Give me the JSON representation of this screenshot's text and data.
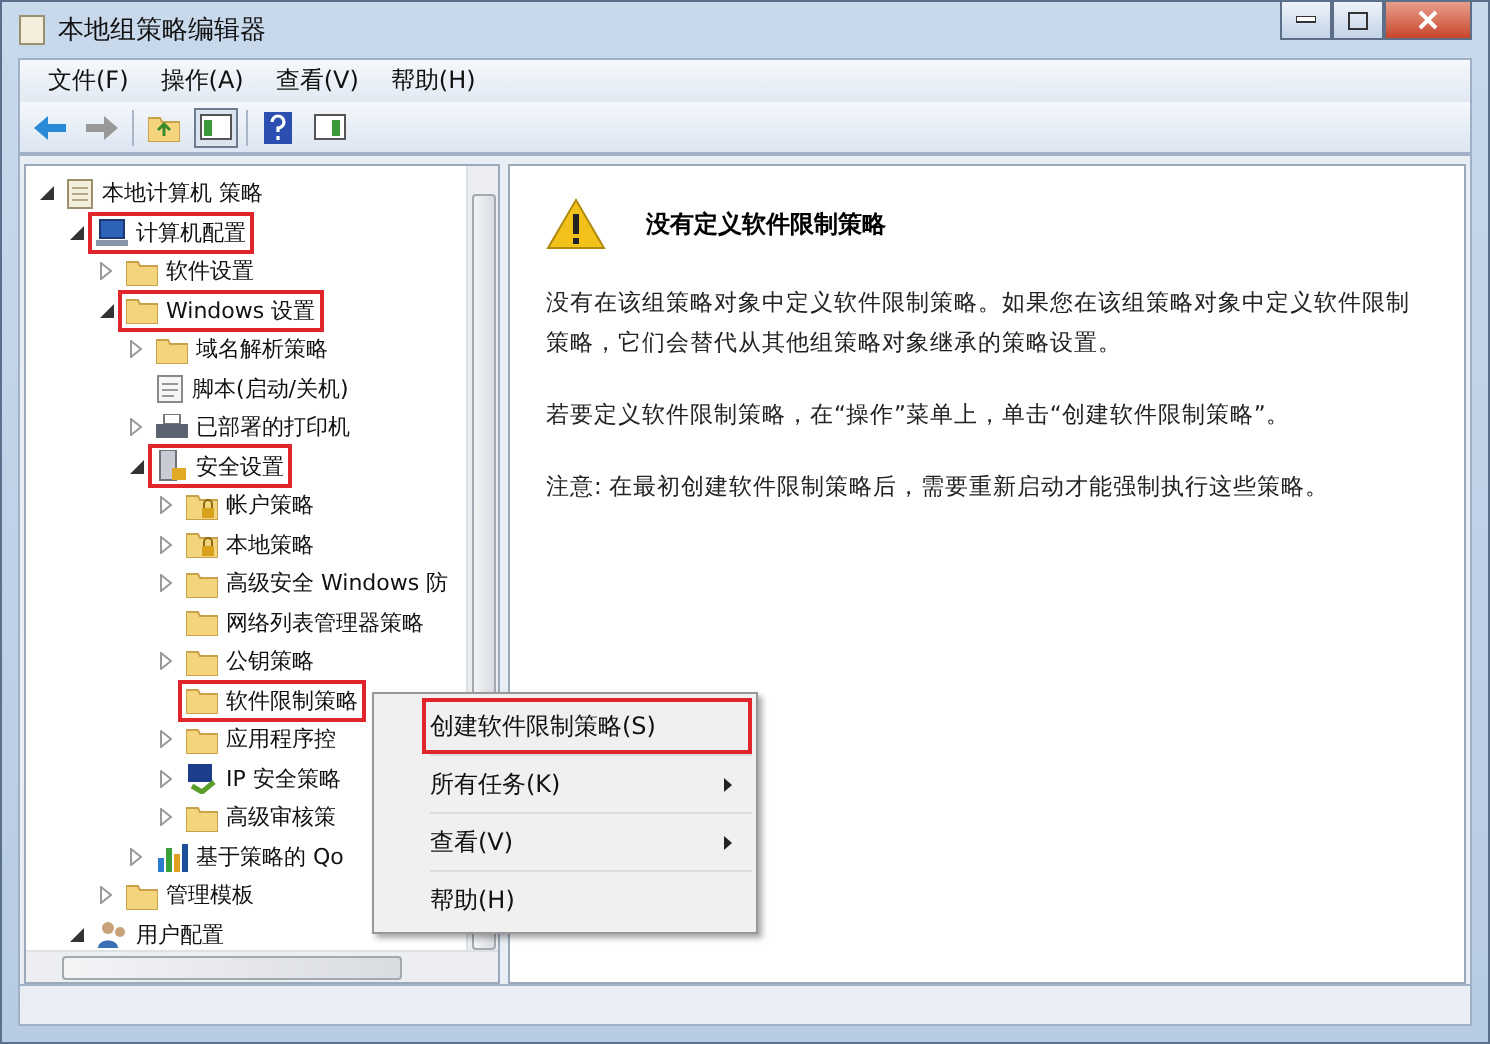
{
  "window": {
    "title": "本地组策略编辑器"
  },
  "menu": [
    "文件(F)",
    "操作(A)",
    "查看(V)",
    "帮助(H)"
  ],
  "tree": [
    {
      "label": "本地计算机 策略",
      "kind": "policy",
      "expanded": true,
      "highlighted": false,
      "children": [
        {
          "label": "计算机配置",
          "kind": "computer",
          "expanded": true,
          "highlighted": true,
          "children": [
            {
              "label": "软件设置",
              "kind": "folder",
              "expanded": false,
              "highlighted": false
            },
            {
              "label": "Windows 设置",
              "kind": "folder",
              "expanded": true,
              "highlighted": true,
              "children": [
                {
                  "label": "域名解析策略",
                  "kind": "folder",
                  "expanded": false,
                  "highlighted": false
                },
                {
                  "label": "脚本(启动/关机)",
                  "kind": "script",
                  "highlighted": false
                },
                {
                  "label": "已部署的打印机",
                  "kind": "printer",
                  "expanded": false,
                  "highlighted": false
                },
                {
                  "label": "安全设置",
                  "kind": "security",
                  "expanded": true,
                  "highlighted": true,
                  "children": [
                    {
                      "label": "帐户策略",
                      "kind": "lockfolder",
                      "expanded": false,
                      "highlighted": false
                    },
                    {
                      "label": "本地策略",
                      "kind": "lockfolder",
                      "expanded": false,
                      "highlighted": false
                    },
                    {
                      "label": "高级安全 Windows 防",
                      "kind": "folder",
                      "expanded": false,
                      "highlighted": false
                    },
                    {
                      "label": "网络列表管理器策略",
                      "kind": "folder",
                      "highlighted": false
                    },
                    {
                      "label": "公钥策略",
                      "kind": "folder",
                      "expanded": false,
                      "highlighted": false
                    },
                    {
                      "label": "软件限制策略",
                      "kind": "folder",
                      "highlighted": true
                    },
                    {
                      "label": "应用程序控",
                      "kind": "folder",
                      "expanded": false,
                      "highlighted": false
                    },
                    {
                      "label": "IP 安全策略",
                      "kind": "ipsec",
                      "expanded": false,
                      "highlighted": false
                    },
                    {
                      "label": "高级审核策",
                      "kind": "folder",
                      "expanded": false,
                      "highlighted": false
                    }
                  ]
                },
                {
                  "label": "基于策略的 Qo",
                  "kind": "chart",
                  "expanded": false,
                  "highlighted": false
                }
              ]
            },
            {
              "label": "管理模板",
              "kind": "folder",
              "expanded": false,
              "highlighted": false
            }
          ]
        },
        {
          "label": "用户配置",
          "kind": "user",
          "expanded": true,
          "highlighted": false
        }
      ]
    }
  ],
  "detail": {
    "title": "没有定义软件限制策略",
    "paragraphs": [
      "没有在该组策略对象中定义软件限制策略。如果您在该组策略对象中定义软件限制策略，它们会替代从其他组策略对象继承的策略设置。",
      "若要定义软件限制策略，在“操作”菜单上，单击“创建软件限制策略”。",
      "注意: 在最初创建软件限制策略后，需要重新启动才能强制执行这些策略。"
    ]
  },
  "context_menu": [
    {
      "label": "创建软件限制策略(S)",
      "has_submenu": false,
      "highlighted": true
    },
    {
      "label": "所有任务(K)",
      "has_submenu": true,
      "highlighted": false
    },
    {
      "label": "查看(V)",
      "has_submenu": true,
      "highlighted": false
    },
    {
      "label": "帮助(H)",
      "has_submenu": false,
      "highlighted": false
    }
  ]
}
